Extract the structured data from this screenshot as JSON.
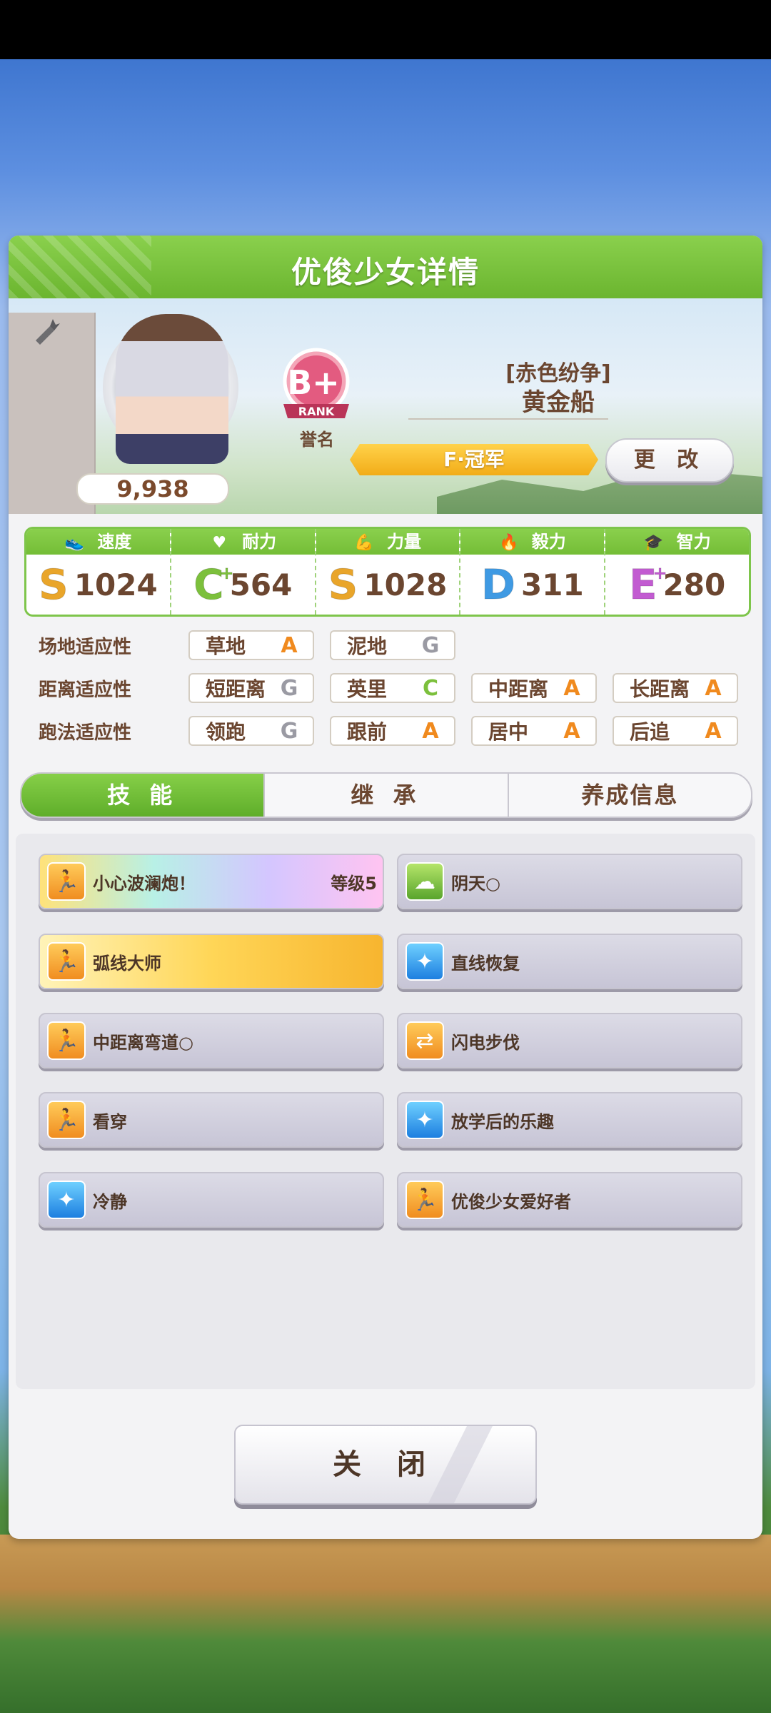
{
  "header": {
    "title": "优俊少女详情"
  },
  "profile": {
    "fans": "9,938",
    "rank_letter": "B+",
    "rank_word": "RANK",
    "rank_caption": "誉名",
    "epithet": "[赤色纷争]",
    "name": "黄金船",
    "title_ribbon": "F·冠军",
    "change_button": "更 改"
  },
  "stats": [
    {
      "label": "速度",
      "icon": "shoe-icon",
      "grade": "S",
      "plus": "",
      "value": "1024",
      "color": "#e9a52a"
    },
    {
      "label": "耐力",
      "icon": "heart-icon",
      "grade": "C",
      "plus": "+",
      "value": "564",
      "color": "#7cc03c"
    },
    {
      "label": "力量",
      "icon": "arm-icon",
      "grade": "S",
      "plus": "",
      "value": "1028",
      "color": "#e9a52a"
    },
    {
      "label": "毅力",
      "icon": "flame-icon",
      "grade": "D",
      "plus": "",
      "value": "311",
      "color": "#3f9ae3"
    },
    {
      "label": "智力",
      "icon": "graduation-cap-icon",
      "grade": "E",
      "plus": "+",
      "value": "280",
      "color": "#c25bd1"
    }
  ],
  "aptitudes": [
    {
      "label": "场地适应性",
      "items": [
        {
          "name": "草地",
          "grade": "A"
        },
        {
          "name": "泥地",
          "grade": "G"
        }
      ]
    },
    {
      "label": "距离适应性",
      "items": [
        {
          "name": "短距离",
          "grade": "G"
        },
        {
          "name": "英里",
          "grade": "C"
        },
        {
          "name": "中距离",
          "grade": "A"
        },
        {
          "name": "长距离",
          "grade": "A"
        }
      ]
    },
    {
      "label": "跑法适应性",
      "items": [
        {
          "name": "领跑",
          "grade": "G"
        },
        {
          "name": "跟前",
          "grade": "A"
        },
        {
          "name": "居中",
          "grade": "A"
        },
        {
          "name": "后追",
          "grade": "A"
        }
      ]
    }
  ],
  "tabs": [
    {
      "label": "技 能"
    },
    {
      "label": "继 承"
    },
    {
      "label": "养成信息"
    }
  ],
  "skills": [
    {
      "name": "小心波澜炮！",
      "level": "等级5",
      "icon": "runner-icon"
    },
    {
      "name": "阴天○",
      "level": "",
      "icon": "cloud-icon"
    },
    {
      "name": "弧线大师",
      "level": "",
      "icon": "runner-icon"
    },
    {
      "name": "直线恢复",
      "level": "",
      "icon": "sparkle-icon"
    },
    {
      "name": "中距离弯道○",
      "level": "",
      "icon": "runner-icon"
    },
    {
      "name": "闪电步伐",
      "level": "",
      "icon": "arrows-icon"
    },
    {
      "name": "看穿",
      "level": "",
      "icon": "runner-icon"
    },
    {
      "name": "放学后的乐趣",
      "level": "",
      "icon": "sparkle-icon"
    },
    {
      "name": "冷静",
      "level": "",
      "icon": "sparkle-icon"
    },
    {
      "name": "优俊少女爱好者",
      "level": "",
      "icon": "runner-icon"
    }
  ],
  "close_button": "关 闭"
}
